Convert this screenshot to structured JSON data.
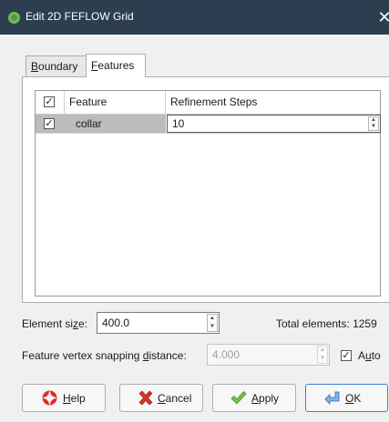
{
  "window": {
    "title": "Edit 2D FEFLOW Grid",
    "close_glyph": "✕"
  },
  "tabs": [
    {
      "label": "Boundary",
      "mnemonic": "B",
      "rest": "oundary",
      "active": false
    },
    {
      "label": "Features",
      "mnemonic": "F",
      "rest": "eatures",
      "active": true
    }
  ],
  "features_table": {
    "columns": [
      "",
      "Feature",
      "Refinement Steps"
    ],
    "rows": [
      {
        "checked": true,
        "feature": "collar",
        "refinement_steps": "10",
        "selected": true
      }
    ],
    "header_checked": true
  },
  "element_size": {
    "label_pre": "Element si",
    "label_mn": "z",
    "label_post": "e:",
    "value": "400.0"
  },
  "total_elements": {
    "label": "Total elements:",
    "value": "1259"
  },
  "vertex_snapping": {
    "label_pre": "Feature vertex snapping ",
    "label_mn": "d",
    "label_post": "istance:",
    "value": "4.000",
    "enabled": false
  },
  "auto": {
    "label_pre": "A",
    "label_mn": "u",
    "label_post": "to",
    "checked": true
  },
  "buttons": {
    "help": {
      "mn": "H",
      "rest": "elp",
      "icon": "lifebuoy-icon"
    },
    "cancel": {
      "mn": "C",
      "rest": "ancel",
      "icon": "x-mark-icon"
    },
    "apply": {
      "mn": "A",
      "rest": "pply",
      "icon": "checkmark-icon"
    },
    "ok": {
      "mn": "O",
      "rest": "K",
      "icon": "enter-arrow-icon"
    }
  },
  "colors": {
    "titlebar": "#2c3e50",
    "selection": "#bcbcbc"
  }
}
